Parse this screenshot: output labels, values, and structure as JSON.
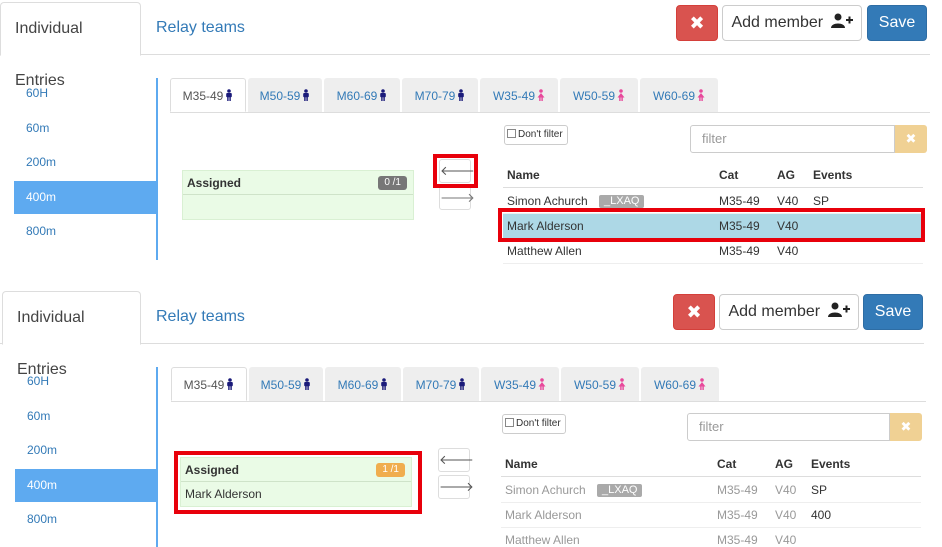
{
  "top_tabs": [
    "Individual Entries",
    "Relay teams"
  ],
  "header": {
    "close_icon": "✖",
    "add_member_label": "Add member",
    "save_label": "Save"
  },
  "events": [
    "60H",
    "60m",
    "200m",
    "400m",
    "800m"
  ],
  "active_event": "400m",
  "categories": [
    {
      "label": "M35-49",
      "gender": "male"
    },
    {
      "label": "M50-59",
      "gender": "male"
    },
    {
      "label": "M60-69",
      "gender": "male"
    },
    {
      "label": "M70-79",
      "gender": "male"
    },
    {
      "label": "W35-49",
      "gender": "female"
    },
    {
      "label": "W50-59",
      "gender": "female"
    },
    {
      "label": "W60-69",
      "gender": "female"
    }
  ],
  "colors": {
    "male_icon": "#1a1a7a",
    "female_icon": "#e8489b",
    "highlight_frame": "#e8000b",
    "badge_empty": "#777777",
    "badge_full": "#f0ad4e"
  },
  "assigned_label": "Assigned",
  "dont_filter_label": "Don't filter",
  "filter_placeholder": "filter",
  "table_headers": [
    "Name",
    "Cat",
    "AG",
    "Events"
  ],
  "before": {
    "badge": "0 /1",
    "assigned_members": [],
    "members": [
      {
        "name": "Simon Achurch",
        "tag": "_LXAQ",
        "cat": "M35-49",
        "ag": "V40",
        "events": "SP"
      },
      {
        "name": "Mark Alderson",
        "tag": "",
        "cat": "M35-49",
        "ag": "V40",
        "events": ""
      },
      {
        "name": "Matthew Allen",
        "tag": "",
        "cat": "M35-49",
        "ag": "V40",
        "events": ""
      }
    ]
  },
  "after": {
    "badge": "1 /1",
    "assigned_members": [
      "Mark Alderson"
    ],
    "members": [
      {
        "name": "Simon Achurch",
        "tag": "_LXAQ",
        "cat": "M35-49",
        "ag": "V40",
        "events": "SP"
      },
      {
        "name": "Mark Alderson",
        "tag": "",
        "cat": "M35-49",
        "ag": "V40",
        "events": "400"
      },
      {
        "name": "Matthew Allen",
        "tag": "",
        "cat": "M35-49",
        "ag": "V40",
        "events": ""
      }
    ]
  },
  "arrow_icons": {
    "left": "🡐",
    "right": "🡒"
  }
}
